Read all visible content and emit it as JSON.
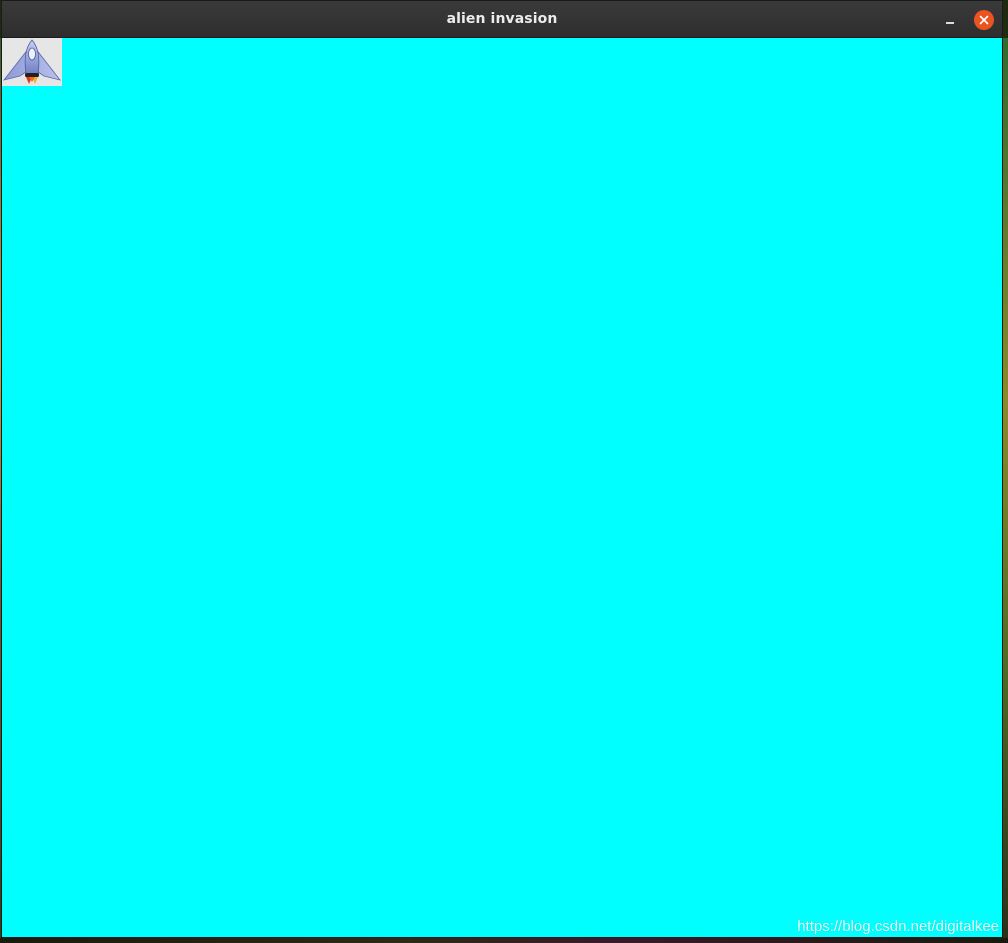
{
  "window": {
    "title": "alien invasion",
    "buttons": {
      "minimize_icon": "minimize-icon",
      "close_icon": "close-icon"
    }
  },
  "game": {
    "background_color": "#00ffff",
    "ship_icon": "ship-icon"
  },
  "watermark": "https://blog.csdn.net/digitalkee",
  "colors": {
    "titlebar": "#2e2e2e",
    "close_button": "#e95420",
    "screen": "#00ffff"
  }
}
